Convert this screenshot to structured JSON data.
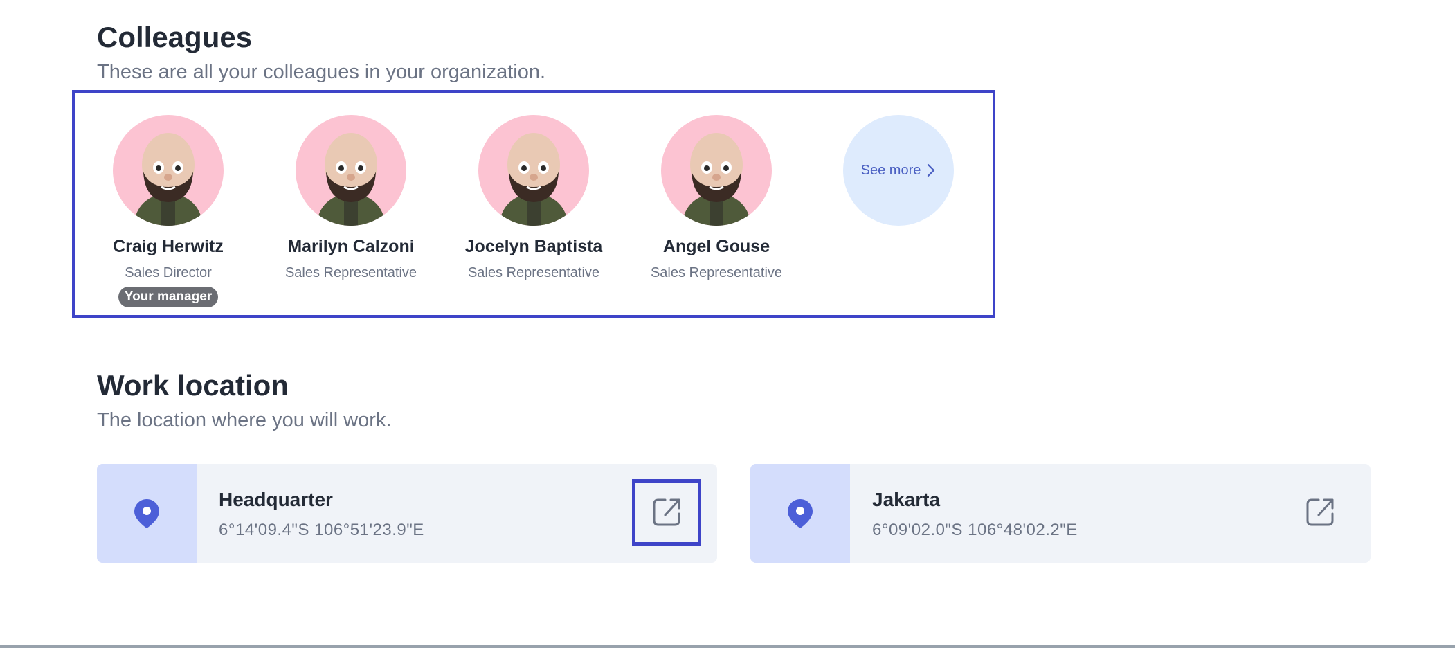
{
  "colleagues_section": {
    "title": "Colleagues",
    "subtitle": "These are all your colleagues in your organization.",
    "people": [
      {
        "name": "Craig Herwitz",
        "role": "Sales Director",
        "badge": "Your manager"
      },
      {
        "name": "Marilyn Calzoni",
        "role": "Sales Representative"
      },
      {
        "name": "Jocelyn Baptista",
        "role": "Sales Representative"
      },
      {
        "name": "Angel Gouse",
        "role": "Sales Representative"
      }
    ],
    "see_more_label": "See more"
  },
  "work_location_section": {
    "title": "Work location",
    "subtitle": "The location where you will work.",
    "locations": [
      {
        "name": "Headquarter",
        "coordinates": "6°14'09.4\"S 106°51'23.9\"E"
      },
      {
        "name": "Jakarta",
        "coordinates": "6°09'02.0\"S 106°48'02.2\"E"
      }
    ]
  },
  "icons": {
    "location": "map-pin-icon",
    "external": "external-link-icon",
    "chevron": "chevron-right-icon"
  },
  "colors": {
    "highlight_border": "#3e44c8",
    "avatar_bg": "#fcc3d2",
    "see_more_bg": "#deebfd",
    "pin": "#4c5fd8"
  }
}
